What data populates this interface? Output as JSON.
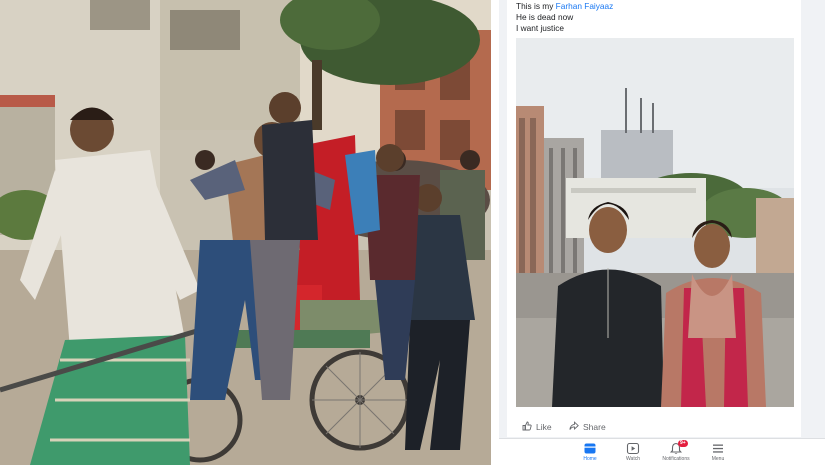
{
  "post": {
    "line1_prefix": "This is my ",
    "line1_name": "Farhan Faiyaaz",
    "line2": "He is dead now",
    "line3": "I want justice"
  },
  "actions": {
    "like_label": "Like",
    "share_label": "Share"
  },
  "nav": {
    "items": [
      {
        "label": "Home",
        "icon": "home-icon",
        "active": true
      },
      {
        "label": "Watch",
        "icon": "watch-icon",
        "active": false
      },
      {
        "label": "Notifications",
        "icon": "bell-icon",
        "active": false,
        "badge": "9+"
      },
      {
        "label": "Menu",
        "icon": "menu-icon",
        "active": false
      }
    ]
  },
  "colors": {
    "brand": "#1877f2",
    "badge": "#e41e3f",
    "text": "#1c1e21",
    "muted": "#65676b"
  }
}
